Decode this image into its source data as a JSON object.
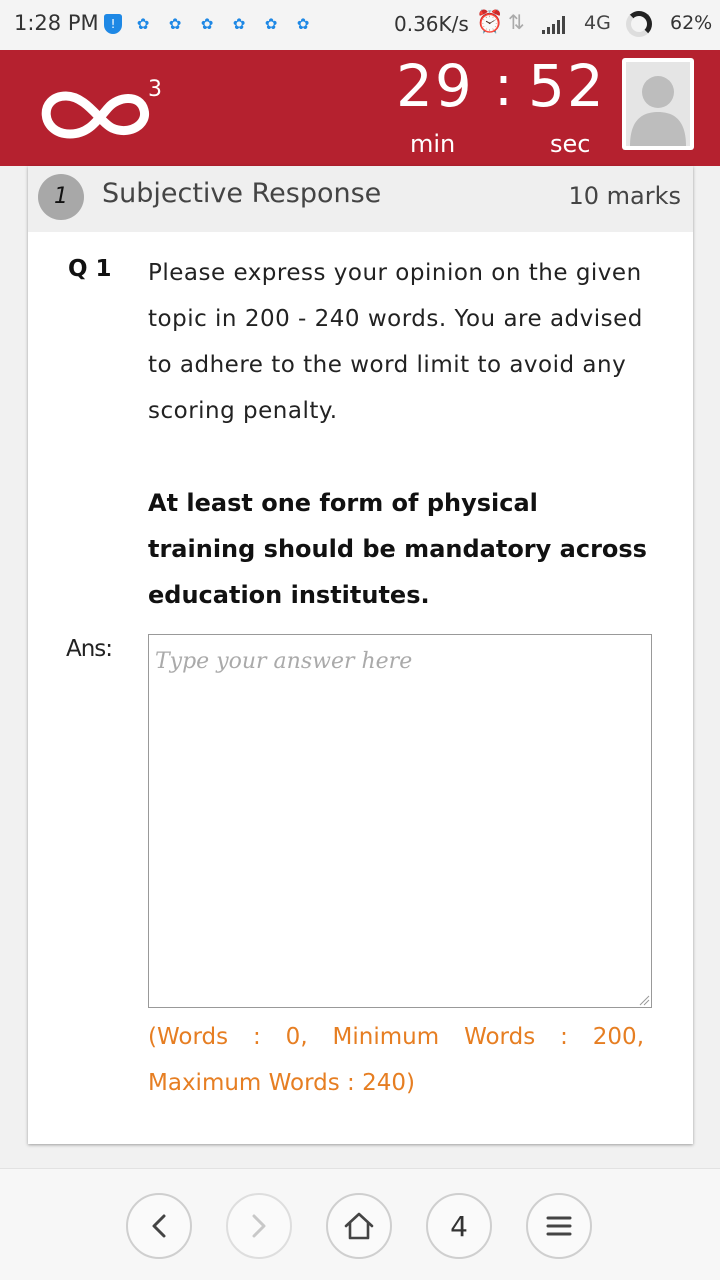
{
  "status_bar": {
    "time": "1:28 PM",
    "network_speed": "0.36K/s",
    "network_type": "4G",
    "battery": "62%",
    "notification_icons": [
      "shield-icon",
      "app-icon",
      "app-icon",
      "app-icon",
      "app-icon",
      "app-icon",
      "app-icon"
    ]
  },
  "header": {
    "brand_superscript": "3",
    "timer_minutes": "29",
    "timer_separator": ":",
    "timer_seconds": "52",
    "minutes_label": "min",
    "seconds_label": "sec",
    "accent_color": "#b5212f"
  },
  "question": {
    "section_number": "1",
    "type": "Subjective Response",
    "marks": "10 marks",
    "number_label": "Q 1",
    "instructions": "Please express your opinion on the given topic in 200 - 240 words. You are advised to adhere to the word limit to avoid any scoring penalty.",
    "topic": "At least one form of physical training should be mandatory across education institutes."
  },
  "answer": {
    "label": "Ans:",
    "placeholder": "Type your answer here",
    "value": "",
    "word_count_text": "(Words : 0, Minimum Words : 200, Maximum Words : 240)",
    "word_count_color": "#e67e22"
  },
  "bottom_nav": {
    "tab_count": "4",
    "back_icon": "chevron-left-icon",
    "forward_icon": "chevron-right-icon",
    "home_icon": "home-icon",
    "menu_icon": "menu-icon"
  }
}
